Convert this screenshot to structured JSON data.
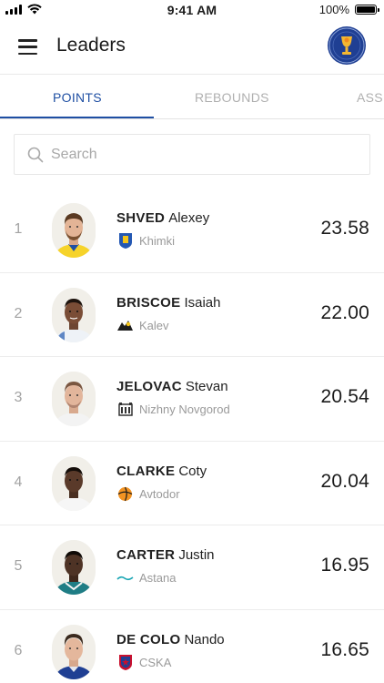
{
  "status_bar": {
    "time": "9:41 AM",
    "battery": "100%",
    "battery_level": 1.0
  },
  "header": {
    "title": "Leaders",
    "logo_icon": "league-logo-icon",
    "menu_icon": "menu-icon"
  },
  "tabs": [
    {
      "label": "POINTS",
      "active": true
    },
    {
      "label": "REBOUNDS",
      "active": false
    },
    {
      "label": "ASSISTS",
      "active": false
    }
  ],
  "search": {
    "placeholder": "Search",
    "value": ""
  },
  "colors": {
    "accent": "#1f4fa3",
    "logo_bg": "#1f3f93",
    "muted_text": "#9a9a9a"
  },
  "leaders": [
    {
      "rank": "1",
      "surname": "SHVED",
      "first_name": "Alexey",
      "team": "Khimki",
      "team_icon": "khimki-logo-icon",
      "value": "23.58"
    },
    {
      "rank": "2",
      "surname": "BRISCOE",
      "first_name": "Isaiah",
      "team": "Kalev",
      "team_icon": "kalev-logo-icon",
      "value": "22.00"
    },
    {
      "rank": "3",
      "surname": "JELOVAC",
      "first_name": "Stevan",
      "team": "Nizhny Novgorod",
      "team_icon": "nizhny-novgorod-logo-icon",
      "value": "20.54"
    },
    {
      "rank": "4",
      "surname": "CLARKE",
      "first_name": "Coty",
      "team": "Avtodor",
      "team_icon": "avtodor-logo-icon",
      "value": "20.04"
    },
    {
      "rank": "5",
      "surname": "CARTER",
      "first_name": "Justin",
      "team": "Astana",
      "team_icon": "astana-logo-icon",
      "value": "16.95"
    },
    {
      "rank": "6",
      "surname": "DE COLO",
      "first_name": "Nando",
      "team": "CSKA",
      "team_icon": "cska-logo-icon",
      "value": "16.65"
    }
  ]
}
